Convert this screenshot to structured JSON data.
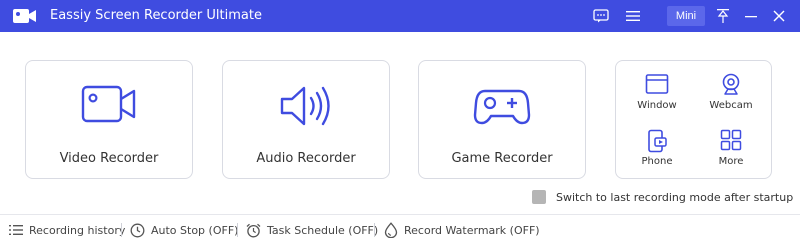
{
  "app": {
    "title": "Eassiy Screen Recorder Ultimate",
    "accent_color": "#3f4ce0",
    "icons": [
      "video-camera-logo-icon"
    ]
  },
  "titlebar": {
    "mini_label": "Mini",
    "buttons": [
      "feedback-icon",
      "menu-icon",
      "mini-button",
      "pin-icon",
      "minimize-icon",
      "close-icon"
    ]
  },
  "recorders": {
    "video_label": "Video Recorder",
    "audio_label": "Audio Recorder",
    "game_label": "Game Recorder"
  },
  "more_panel": {
    "window_label": "Window",
    "webcam_label": "Webcam",
    "phone_label": "Phone",
    "more_label": "More"
  },
  "switch_option": {
    "label": "Switch to last recording mode after startup",
    "checked": false
  },
  "bottom_bar": {
    "history_label": "Recording history",
    "autostop_label": "Auto Stop (OFF)",
    "task_label": "Task Schedule (OFF)",
    "watermark_label": "Record Watermark (OFF)"
  }
}
